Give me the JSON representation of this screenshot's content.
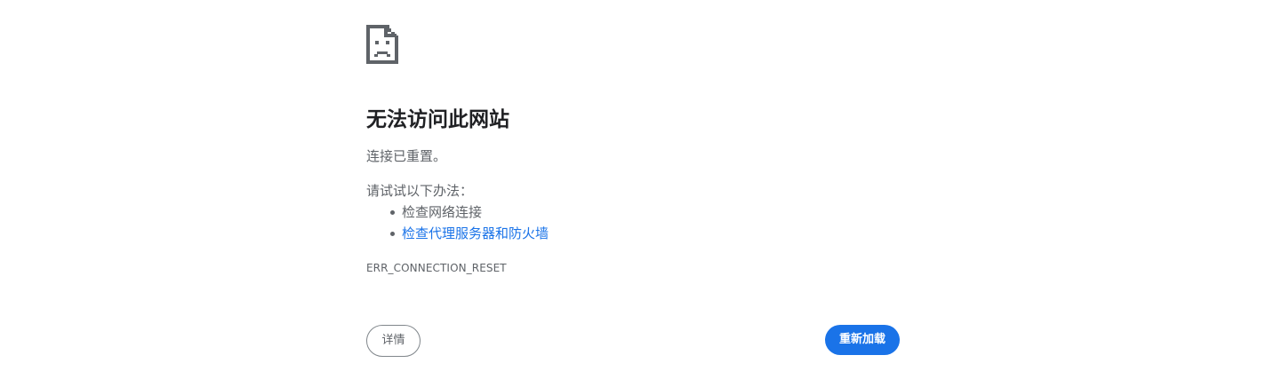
{
  "icon": {
    "name": "sad-page-icon"
  },
  "error": {
    "title": "无法访问此网站",
    "summary": "连接已重置。",
    "try_label": "请试试以下办法：",
    "suggestions": [
      {
        "text": "检查网络连接",
        "is_link": false
      },
      {
        "text": "检查代理服务器和防火墙",
        "is_link": true
      }
    ],
    "code": "ERR_CONNECTION_RESET"
  },
  "buttons": {
    "details_label": "详情",
    "reload_label": "重新加载"
  },
  "colors": {
    "text_primary": "#202124",
    "text_secondary": "#5f6368",
    "link": "#1a73e8",
    "reload_bg": "#1a73e8"
  }
}
